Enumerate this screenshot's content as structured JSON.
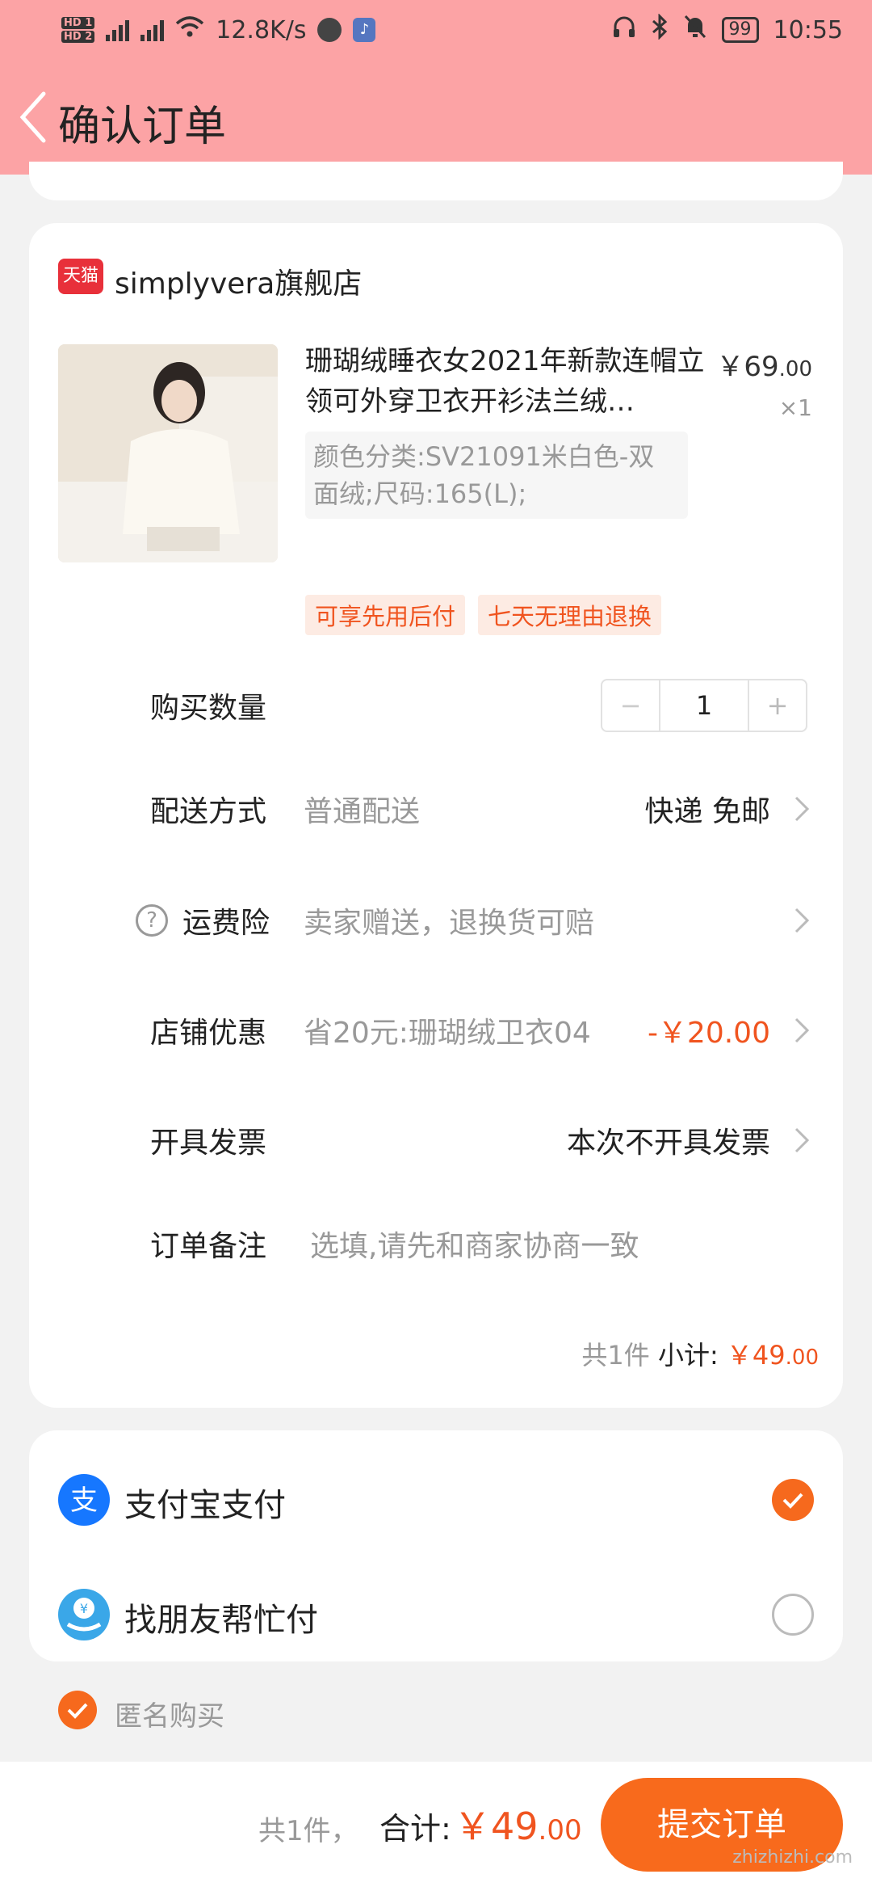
{
  "status_bar": {
    "network_speed": "12.8K/s",
    "battery": "99",
    "time": "10:55",
    "hd1": "HD 1",
    "hd2": "HD 2"
  },
  "header": {
    "title": "确认订单"
  },
  "shop": {
    "badge": "天猫",
    "name": "simplyvera旗舰店"
  },
  "product": {
    "name": "珊瑚绒睡衣女2021年新款连帽立领可外穿卫衣开衫法兰绒…",
    "price_main": "￥69",
    "price_cents": ".00",
    "quantity": "×1",
    "sku": "颜色分类:SV21091米白色-双面绒;尺码:165(L);",
    "tags": [
      "可享先用后付",
      "七天无理由退换"
    ]
  },
  "rows": {
    "quantity_label": "购买数量",
    "quantity_value": "1",
    "delivery_label": "配送方式",
    "delivery_sub": "普通配送",
    "delivery_value": "快递 免邮",
    "insurance_label": "运费险",
    "insurance_sub": "卖家赠送，退换货可赔",
    "discount_label": "店铺优惠",
    "discount_sub": "省20元:珊瑚绒卫衣04",
    "discount_value": "-￥20.00",
    "invoice_label": "开具发票",
    "invoice_value": "本次不开具发票",
    "note_label": "订单备注",
    "note_placeholder": "选填,请先和商家协商一致"
  },
  "subtotal": {
    "count": "共1件",
    "label": "小计:",
    "amount_main": "￥49",
    "amount_cents": ".00"
  },
  "payment": {
    "alipay_label": "支付宝支付",
    "friend_label": "找朋友帮忙付",
    "anonymous_label": "匿名购买"
  },
  "bottom_bar": {
    "count": "共1件，",
    "total_label": "合计:",
    "total_main": "￥49",
    "total_cents": ".00",
    "submit_label": "提交订单"
  },
  "watermark": "zhizhizhi.com",
  "colors": {
    "header_bg": "#fca3a5",
    "accent": "#f0541f",
    "submit_bg": "#f86a1c",
    "alipay_blue": "#1677ff"
  }
}
